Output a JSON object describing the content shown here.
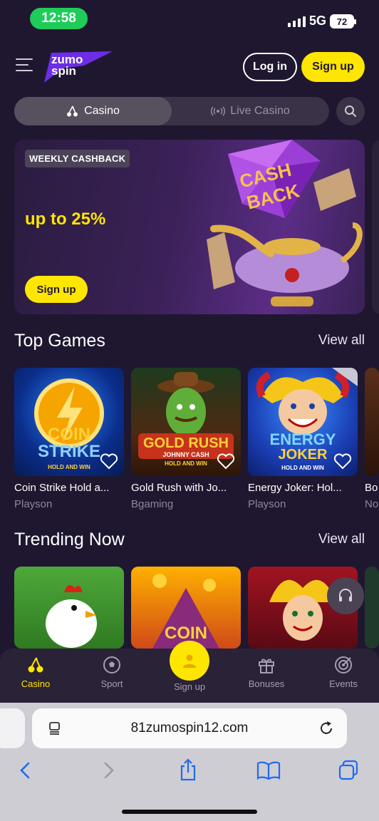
{
  "status_bar": {
    "time": "12:58",
    "network": "5G",
    "battery": "72"
  },
  "header": {
    "logo_line1": "zumo",
    "logo_line2": "spin",
    "login_label": "Log in",
    "signup_label": "Sign up"
  },
  "tabs": [
    {
      "label": "Casino",
      "active": true
    },
    {
      "label": "Live Casino",
      "active": false
    }
  ],
  "banner": {
    "badge": "WEEKLY CASHBACK",
    "offer": "up to 25%",
    "button": "Sign up",
    "art_text_line1": "CASH",
    "art_text_line2": "BACK"
  },
  "top_games": {
    "title": "Top Games",
    "view_all": "View all",
    "items": [
      {
        "name": "Coin Strike Hold a...",
        "provider": "Playson",
        "art_line1": "COIN",
        "art_line2": "STRIKE",
        "art_sub": "HOLD AND WIN"
      },
      {
        "name": "Gold Rush with Jo...",
        "provider": "Bgaming",
        "art_line1": "GOLD RUSH",
        "art_line2": "JOHNNY CASH",
        "art_sub": "HOLD AND WIN"
      },
      {
        "name": "Energy Joker: Hol...",
        "provider": "Playson",
        "art_line1": "ENERGY",
        "art_line2": "JOKER",
        "art_sub": "HOLD AND WIN"
      },
      {
        "name": "Bo",
        "provider": "No"
      }
    ]
  },
  "trending": {
    "title": "Trending Now",
    "view_all": "View all",
    "items": [
      {
        "art": "chicken"
      },
      {
        "art_line1": "COIN"
      },
      {
        "art": "jester"
      }
    ]
  },
  "bottom_nav": [
    {
      "label": "Casino",
      "icon": "cherries-icon",
      "active": true
    },
    {
      "label": "Sport",
      "icon": "soccer-ball-icon",
      "active": false
    },
    {
      "label": "Sign up",
      "icon": "user-icon",
      "active": false
    },
    {
      "label": "Bonuses",
      "icon": "gift-icon",
      "active": false
    },
    {
      "label": "Events",
      "icon": "target-icon",
      "active": false
    }
  ],
  "browser": {
    "url": "81zumospin12.com"
  },
  "colors": {
    "accent": "#ffe600",
    "background": "#1f1730",
    "panel": "#3a3347"
  }
}
